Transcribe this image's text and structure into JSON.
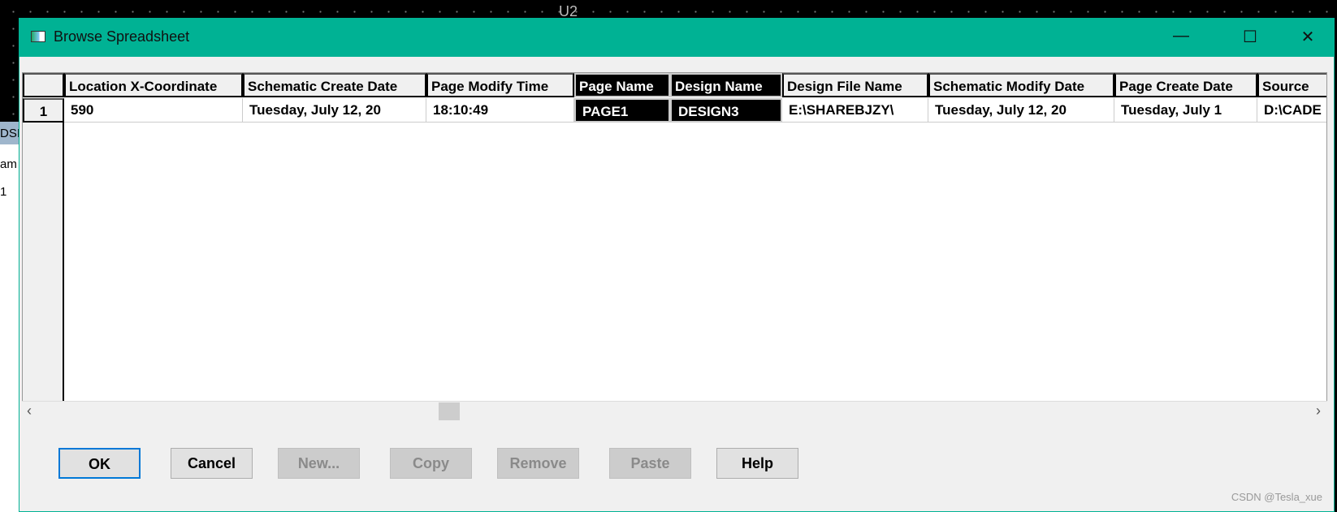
{
  "background": {
    "label": "U2",
    "side_texts": [
      "DSI",
      "am",
      "1"
    ]
  },
  "window": {
    "title": "Browse Spreadsheet",
    "accent": "#00b294"
  },
  "grid": {
    "columns": [
      "Location X-Coordinate",
      "Schematic Create Date",
      "Page Modify Time",
      "Page Name",
      "Design Name",
      "Design File Name",
      "Schematic Modify Date",
      "Page Create Date",
      "Source"
    ],
    "selected_columns": [
      "Page Name",
      "Design Name"
    ],
    "rows": [
      {
        "index": "1",
        "cells": [
          "590",
          "Tuesday, July 12, 20",
          "18:10:49",
          "PAGE1",
          "DESIGN3",
          "E:\\SHAREBJZY\\",
          "Tuesday, July 12, 20",
          "Tuesday, July 1",
          "D:\\CADE"
        ]
      }
    ]
  },
  "buttons": [
    {
      "label": "OK",
      "enabled": true,
      "default": true
    },
    {
      "label": "Cancel",
      "enabled": true
    },
    {
      "label": "New...",
      "enabled": false
    },
    {
      "label": "Copy",
      "enabled": false
    },
    {
      "label": "Remove",
      "enabled": false
    },
    {
      "label": "Paste",
      "enabled": false
    },
    {
      "label": "Help",
      "enabled": true
    }
  ],
  "watermark": "CSDN @Tesla_xue"
}
